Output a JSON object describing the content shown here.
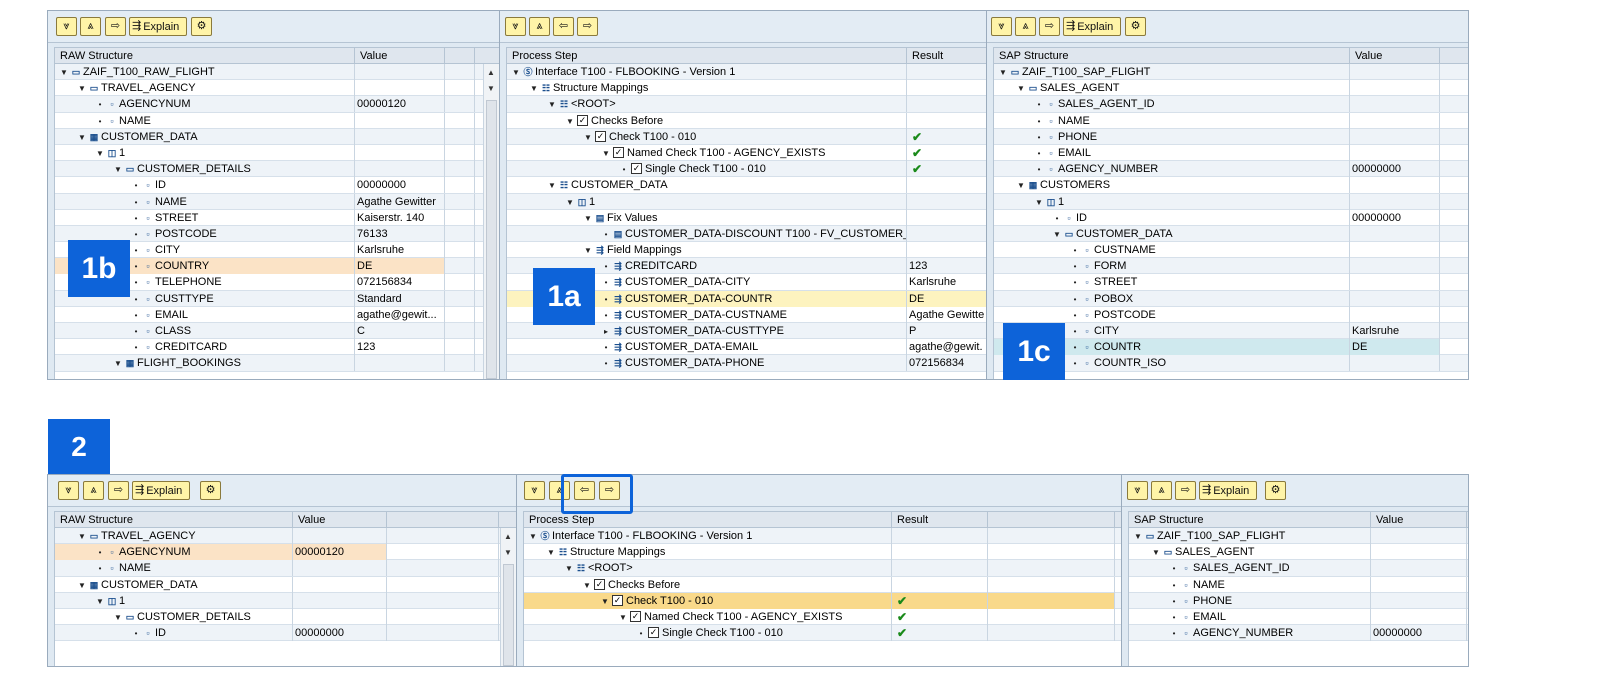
{
  "toolbar": {
    "explain_label": "Explain"
  },
  "top": {
    "raw": {
      "headers": [
        "RAW Structure",
        "Value"
      ],
      "rows": [
        {
          "indent": 0,
          "tw": "▼",
          "icon": "▭",
          "name": "ZAIF_T100_RAW_FLIGHT",
          "value": ""
        },
        {
          "indent": 1,
          "tw": "▼",
          "icon": "▭",
          "name": "TRAVEL_AGENCY",
          "value": ""
        },
        {
          "indent": 2,
          "tw": "•",
          "icon": "▫",
          "name": "AGENCYNUM",
          "value": "00000120"
        },
        {
          "indent": 2,
          "tw": "•",
          "icon": "▫",
          "name": "NAME",
          "value": ""
        },
        {
          "indent": 1,
          "tw": "▼",
          "icon": "▦",
          "name": "CUSTOMER_DATA",
          "value": ""
        },
        {
          "indent": 2,
          "tw": "▼",
          "icon": "◫",
          "name": "1",
          "value": ""
        },
        {
          "indent": 3,
          "tw": "▼",
          "icon": "▭",
          "name": "CUSTOMER_DETAILS",
          "value": ""
        },
        {
          "indent": 4,
          "tw": "•",
          "icon": "▫",
          "name": "ID",
          "value": "00000000"
        },
        {
          "indent": 4,
          "tw": "•",
          "icon": "▫",
          "name": "NAME",
          "value": "Agathe Gewitter"
        },
        {
          "indent": 4,
          "tw": "•",
          "icon": "▫",
          "name": "STREET",
          "value": "Kaiserstr. 140"
        },
        {
          "indent": 4,
          "tw": "•",
          "icon": "▫",
          "name": "POSTCODE",
          "value": "76133"
        },
        {
          "indent": 4,
          "tw": "•",
          "icon": "▫",
          "name": "CITY",
          "value": "Karlsruhe"
        },
        {
          "indent": 4,
          "tw": "•",
          "icon": "▫",
          "name": "COUNTRY",
          "value": "DE",
          "hl": "orange"
        },
        {
          "indent": 4,
          "tw": "•",
          "icon": "▫",
          "name": "TELEPHONE",
          "value": "072156834"
        },
        {
          "indent": 4,
          "tw": "•",
          "icon": "▫",
          "name": "CUSTTYPE",
          "value": "Standard"
        },
        {
          "indent": 4,
          "tw": "•",
          "icon": "▫",
          "name": "EMAIL",
          "value": "agathe@gewit..."
        },
        {
          "indent": 4,
          "tw": "•",
          "icon": "▫",
          "name": "CLASS",
          "value": "C"
        },
        {
          "indent": 4,
          "tw": "•",
          "icon": "▫",
          "name": "CREDITCARD",
          "value": "123"
        },
        {
          "indent": 3,
          "tw": "▼",
          "icon": "▦",
          "name": "FLIGHT_BOOKINGS",
          "value": ""
        }
      ]
    },
    "process": {
      "headers": [
        "Process Step",
        "Result"
      ],
      "rows": [
        {
          "indent": 0,
          "tw": "▼",
          "icon": "Ⓢ",
          "name": "Interface T100 - FLBOOKING - Version 1",
          "value": ""
        },
        {
          "indent": 1,
          "tw": "▼",
          "icon": "☷",
          "name": "Structure Mappings",
          "value": ""
        },
        {
          "indent": 2,
          "tw": "▼",
          "icon": "☷",
          "name": "<ROOT>",
          "value": ""
        },
        {
          "indent": 3,
          "tw": "▼",
          "chk": true,
          "name": "Checks Before",
          "value": ""
        },
        {
          "indent": 4,
          "tw": "▼",
          "chk": true,
          "name": "Check T100 - 010",
          "value": "",
          "tick": true
        },
        {
          "indent": 5,
          "tw": "▼",
          "chk": true,
          "name": "Named Check T100 - AGENCY_EXISTS",
          "value": "",
          "tick": true
        },
        {
          "indent": 6,
          "tw": "•",
          "chk": true,
          "name": "Single Check T100 - 010",
          "value": "",
          "tick": true
        },
        {
          "indent": 2,
          "tw": "▼",
          "icon": "☷",
          "name": "CUSTOMER_DATA",
          "value": ""
        },
        {
          "indent": 3,
          "tw": "▼",
          "icon": "◫",
          "name": "1",
          "value": ""
        },
        {
          "indent": 4,
          "tw": "▼",
          "icon": "▤",
          "name": "Fix Values",
          "value": ""
        },
        {
          "indent": 5,
          "tw": "•",
          "icon": "▤",
          "name": "CUSTOMER_DATA-DISCOUNT  T100 - FV_CUSTOMER_",
          "value": ""
        },
        {
          "indent": 4,
          "tw": "▼",
          "icon": "⇶",
          "name": "Field Mappings",
          "value": ""
        },
        {
          "indent": 5,
          "tw": "•",
          "icon": "⇶",
          "name": "CREDITCARD",
          "value": "123"
        },
        {
          "indent": 5,
          "tw": "•",
          "icon": "⇶",
          "name": "CUSTOMER_DATA-CITY",
          "value": "Karlsruhe"
        },
        {
          "indent": 5,
          "tw": "•",
          "icon": "⇶",
          "name": "CUSTOMER_DATA-COUNTR",
          "value": "DE",
          "hl": "yellow"
        },
        {
          "indent": 5,
          "tw": "•",
          "icon": "⇶",
          "name": "CUSTOMER_DATA-CUSTNAME",
          "value": "Agathe Gewitte"
        },
        {
          "indent": 5,
          "tw": "▸",
          "icon": "⇶",
          "name": "CUSTOMER_DATA-CUSTTYPE",
          "value": "P"
        },
        {
          "indent": 5,
          "tw": "•",
          "icon": "⇶",
          "name": "CUSTOMER_DATA-EMAIL",
          "value": "agathe@gewit."
        },
        {
          "indent": 5,
          "tw": "•",
          "icon": "⇶",
          "name": "CUSTOMER_DATA-PHONE",
          "value": "072156834"
        }
      ]
    },
    "sap": {
      "headers": [
        "SAP Structure",
        "Value"
      ],
      "rows": [
        {
          "indent": 0,
          "tw": "▼",
          "icon": "▭",
          "name": "ZAIF_T100_SAP_FLIGHT",
          "value": ""
        },
        {
          "indent": 1,
          "tw": "▼",
          "icon": "▭",
          "name": "SALES_AGENT",
          "value": ""
        },
        {
          "indent": 2,
          "tw": "•",
          "icon": "▫",
          "name": "SALES_AGENT_ID",
          "value": ""
        },
        {
          "indent": 2,
          "tw": "•",
          "icon": "▫",
          "name": "NAME",
          "value": ""
        },
        {
          "indent": 2,
          "tw": "•",
          "icon": "▫",
          "name": "PHONE",
          "value": ""
        },
        {
          "indent": 2,
          "tw": "•",
          "icon": "▫",
          "name": "EMAIL",
          "value": ""
        },
        {
          "indent": 2,
          "tw": "•",
          "icon": "▫",
          "name": "AGENCY_NUMBER",
          "value": "00000000"
        },
        {
          "indent": 1,
          "tw": "▼",
          "icon": "▦",
          "name": "CUSTOMERS",
          "value": ""
        },
        {
          "indent": 2,
          "tw": "▼",
          "icon": "◫",
          "name": "1",
          "value": ""
        },
        {
          "indent": 3,
          "tw": "•",
          "icon": "▫",
          "name": "ID",
          "value": "00000000"
        },
        {
          "indent": 3,
          "tw": "▼",
          "icon": "▭",
          "name": "CUSTOMER_DATA",
          "value": ""
        },
        {
          "indent": 4,
          "tw": "•",
          "icon": "▫",
          "name": "CUSTNAME",
          "value": ""
        },
        {
          "indent": 4,
          "tw": "•",
          "icon": "▫",
          "name": "FORM",
          "value": ""
        },
        {
          "indent": 4,
          "tw": "•",
          "icon": "▫",
          "name": "STREET",
          "value": ""
        },
        {
          "indent": 4,
          "tw": "•",
          "icon": "▫",
          "name": "POBOX",
          "value": ""
        },
        {
          "indent": 4,
          "tw": "•",
          "icon": "▫",
          "name": "POSTCODE",
          "value": ""
        },
        {
          "indent": 4,
          "tw": "•",
          "icon": "▫",
          "name": "CITY",
          "value": "Karlsruhe"
        },
        {
          "indent": 4,
          "tw": "•",
          "icon": "▫",
          "name": "COUNTR",
          "value": "DE",
          "hl": "teal"
        },
        {
          "indent": 4,
          "tw": "•",
          "icon": "▫",
          "name": "COUNTR_ISO",
          "value": ""
        }
      ]
    }
  },
  "bottom": {
    "raw": {
      "headers": [
        "RAW Structure",
        "Value"
      ],
      "rows": [
        {
          "indent": 1,
          "tw": "▼",
          "icon": "▭",
          "name": "TRAVEL_AGENCY",
          "value": ""
        },
        {
          "indent": 2,
          "tw": "•",
          "icon": "▫",
          "name": "AGENCYNUM",
          "value": "00000120",
          "hl": "orange"
        },
        {
          "indent": 2,
          "tw": "•",
          "icon": "▫",
          "name": "NAME",
          "value": ""
        },
        {
          "indent": 1,
          "tw": "▼",
          "icon": "▦",
          "name": "CUSTOMER_DATA",
          "value": ""
        },
        {
          "indent": 2,
          "tw": "▼",
          "icon": "◫",
          "name": "1",
          "value": ""
        },
        {
          "indent": 3,
          "tw": "▼",
          "icon": "▭",
          "name": "CUSTOMER_DETAILS",
          "value": ""
        },
        {
          "indent": 4,
          "tw": "•",
          "icon": "▫",
          "name": "ID",
          "value": "00000000"
        }
      ]
    },
    "process": {
      "headers": [
        "Process Step",
        "Result"
      ],
      "rows": [
        {
          "indent": 0,
          "tw": "▼",
          "icon": "Ⓢ",
          "name": "Interface T100 - FLBOOKING - Version 1",
          "value": ""
        },
        {
          "indent": 1,
          "tw": "▼",
          "icon": "☷",
          "name": "Structure Mappings",
          "value": ""
        },
        {
          "indent": 2,
          "tw": "▼",
          "icon": "☷",
          "name": "<ROOT>",
          "value": ""
        },
        {
          "indent": 3,
          "tw": "▼",
          "chk": true,
          "name": "Checks Before",
          "value": ""
        },
        {
          "indent": 4,
          "tw": "▼",
          "chk": true,
          "name": "Check T100 - 010",
          "value": "",
          "tick": true,
          "hl": "gold"
        },
        {
          "indent": 5,
          "tw": "▼",
          "chk": true,
          "name": "Named Check T100 - AGENCY_EXISTS",
          "value": "",
          "tick": true
        },
        {
          "indent": 6,
          "tw": "•",
          "chk": true,
          "name": "Single Check T100 - 010",
          "value": "",
          "tick": true
        }
      ]
    },
    "sap": {
      "headers": [
        "SAP Structure",
        "Value"
      ],
      "rows": [
        {
          "indent": 0,
          "tw": "▼",
          "icon": "▭",
          "name": "ZAIF_T100_SAP_FLIGHT",
          "value": ""
        },
        {
          "indent": 1,
          "tw": "▼",
          "icon": "▭",
          "name": "SALES_AGENT",
          "value": ""
        },
        {
          "indent": 2,
          "tw": "•",
          "icon": "▫",
          "name": "SALES_AGENT_ID",
          "value": ""
        },
        {
          "indent": 2,
          "tw": "•",
          "icon": "▫",
          "name": "NAME",
          "value": ""
        },
        {
          "indent": 2,
          "tw": "•",
          "icon": "▫",
          "name": "PHONE",
          "value": ""
        },
        {
          "indent": 2,
          "tw": "•",
          "icon": "▫",
          "name": "EMAIL",
          "value": ""
        },
        {
          "indent": 2,
          "tw": "•",
          "icon": "▫",
          "name": "AGENCY_NUMBER",
          "value": "00000000"
        }
      ]
    }
  },
  "badges": {
    "b1b": "1b",
    "b1a": "1a",
    "b1c": "1c",
    "b2": "2"
  },
  "colors": {
    "accent": "#0d63d9",
    "button_bg": "#fff4a8",
    "tick": "#1a8a1a",
    "hl_orange": "#fbe3c6",
    "hl_yellow": "#fdf3bf",
    "hl_teal": "#cfe9ee",
    "hl_gold": "#f9d98a"
  }
}
